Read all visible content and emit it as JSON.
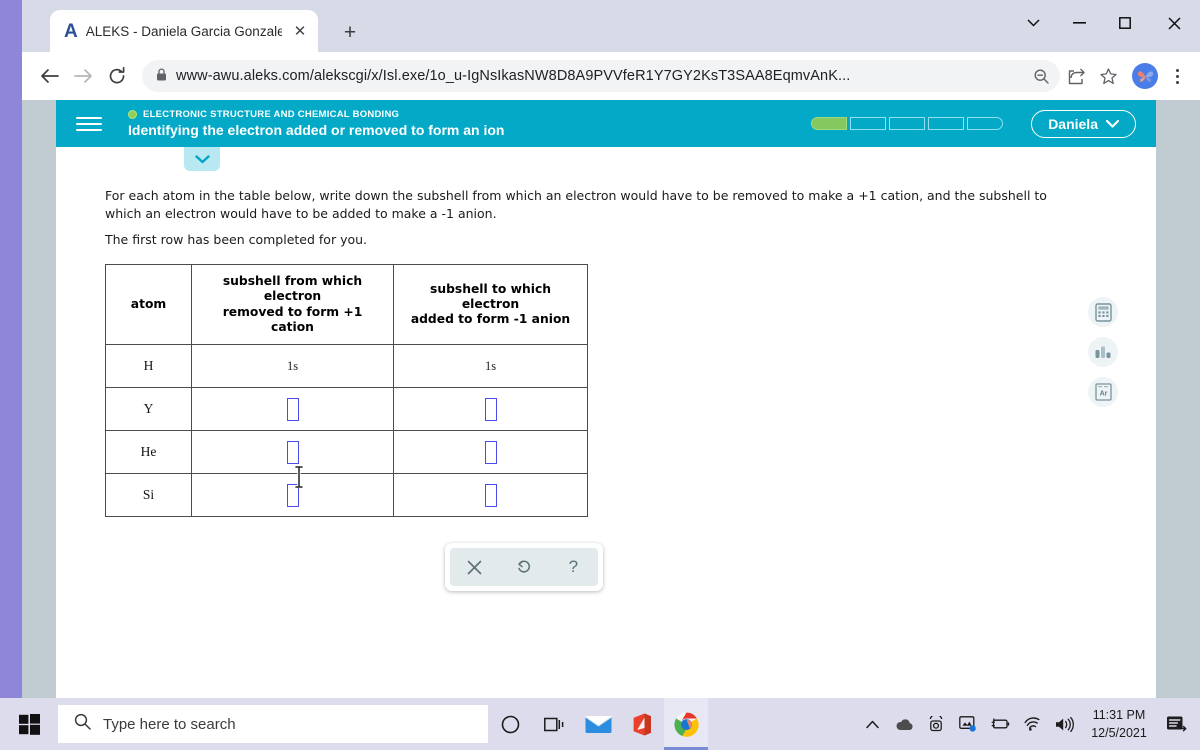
{
  "browser": {
    "tab": {
      "title": "ALEKS - Daniela Garcia Gonzalez",
      "favicon_letter": "A",
      "close_label": "✕"
    },
    "newtab_label": "+",
    "window_controls": {
      "collapse": "∨",
      "minimize": "—",
      "maximize": "□",
      "close": "✕"
    },
    "nav": {
      "back": "←",
      "forward": "→",
      "reload": "⟳"
    },
    "url": {
      "lock": "🔒",
      "domain": "www-awu.aleks.com",
      "path": "/alekscgi/x/Isl.exe/1o_u-IgNsIkasNW8D8A9PVVfeR1Y7GY2KsT3SAA8EqmvAnK...",
      "full": "www-awu.aleks.com/alekscgi/x/Isl.exe/1o_u-IgNsIkasNW8D8A9PVVfeR1Y7GY2KsT3SAA8EqmvAnK..."
    },
    "omnibox_icons": [
      "zoom-out-icon",
      "share-icon",
      "bookmark-star-icon"
    ],
    "profile_name": "butterfly-avatar",
    "menu_label": "⋮"
  },
  "aleks": {
    "objective": "ELECTRONIC STRUCTURE AND CHEMICAL BONDING",
    "lesson_title": "Identifying the electron added or removed to form an ion",
    "progress": {
      "segments": 5,
      "filled": 1
    },
    "user_button": {
      "label": "Daniela",
      "caret": "⌄"
    },
    "collapse_tab": "chevron-down-icon"
  },
  "question": {
    "prompt_line1": "For each atom in the table below, write down the subshell from which an electron would have to be removed to make a +1 cation, and the subshell to which an",
    "prompt_line2": "electron would have to be added to make a -1 anion.",
    "note": "The first row has been completed for you."
  },
  "table": {
    "headers": [
      "atom",
      "subshell from which electron removed to form +1 cation",
      "subshell to which electron added to form -1 anion"
    ],
    "header_parts": {
      "c0": "atom",
      "c1_l1": "subshell from which electron",
      "c1_l2a": "removed to form ",
      "c1_l2b": "+1",
      "c1_l2c": " cation",
      "c2_l1": "subshell to which electron",
      "c2_l2a": "added to form ",
      "c2_l2b": "-1",
      "c2_l2c": " anion"
    },
    "rows": [
      {
        "atom": "H",
        "cation_answer": "1s",
        "anion_answer": "1s",
        "filled": true
      },
      {
        "atom": "Y",
        "cation_answer": "",
        "anion_answer": "",
        "filled": false
      },
      {
        "atom": "He",
        "cation_answer": "",
        "anion_answer": "",
        "filled": false
      },
      {
        "atom": "Si",
        "cation_answer": "",
        "anion_answer": "",
        "filled": false
      }
    ]
  },
  "action_toolbar": {
    "clear_label": "✕",
    "undo_label": "↺",
    "help_label": "?"
  },
  "tool_rail": [
    {
      "name": "calculator-icon",
      "tooltip": "Calculator"
    },
    {
      "name": "data-chart-icon",
      "tooltip": "Data"
    },
    {
      "name": "periodic-table-icon",
      "tooltip": "Periodic Table",
      "symbol": "Ar"
    }
  ],
  "taskbar": {
    "start_icon": "windows-start-icon",
    "search_placeholder": "Type here to search",
    "pinned": [
      {
        "name": "task-view-icon"
      },
      {
        "name": "cortana-icon"
      },
      {
        "name": "mail-icon"
      },
      {
        "name": "office-icon"
      },
      {
        "name": "chrome-icon",
        "active": true
      }
    ],
    "tray": [
      {
        "name": "show-hidden-icons-chevron"
      },
      {
        "name": "onedrive-cloud-icon"
      },
      {
        "name": "camera-privacy-icon"
      },
      {
        "name": "display-settings-icon"
      },
      {
        "name": "battery-icon"
      },
      {
        "name": "wifi-icon"
      },
      {
        "name": "volume-icon"
      }
    ],
    "clock": {
      "time": "11:31 PM",
      "date": "12/5/2021"
    },
    "notifications_icon": "action-center-icon"
  },
  "colors": {
    "aleks_teal": "#03a9c6",
    "progress_green": "#85c85f",
    "input_border_blue": "#4a4aee",
    "desktop_purple": "#9a93dd",
    "page_margin_gray": "#bfcbd1"
  }
}
